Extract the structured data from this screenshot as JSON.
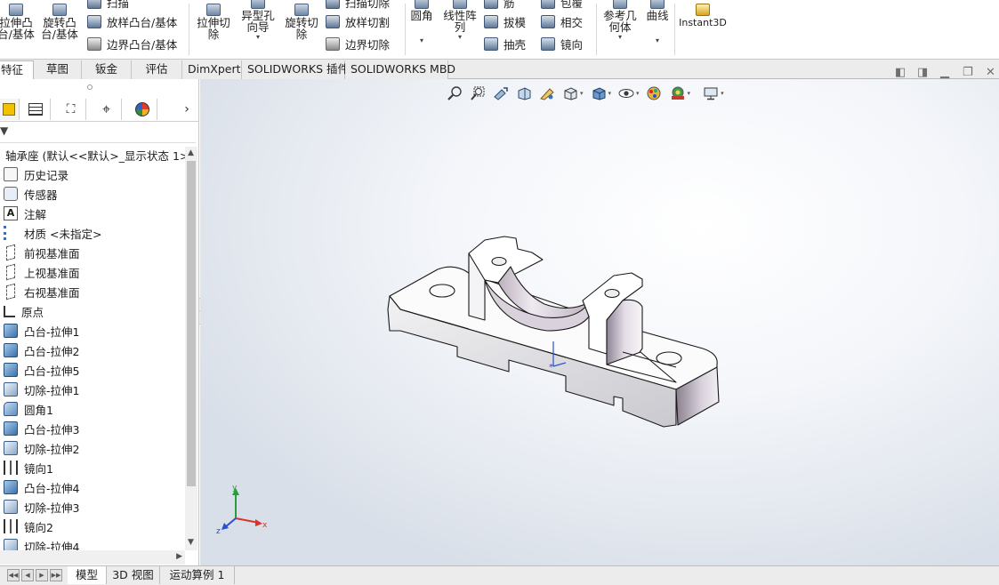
{
  "ribbon": {
    "buttons": [
      {
        "id": "extrude-boss",
        "label": "拉伸凸\n台/基体"
      },
      {
        "id": "revolve-boss",
        "label": "旋转凸\n台/基体"
      },
      {
        "id": "extrude-cut",
        "label": "拉伸切\n除"
      },
      {
        "id": "hole-wizard",
        "label": "异型孔\n向导"
      },
      {
        "id": "revolve-cut",
        "label": "旋转切\n除"
      },
      {
        "id": "fillet",
        "label": "圆角"
      },
      {
        "id": "linear-pattern",
        "label": "线性阵\n列"
      },
      {
        "id": "reference-geometry",
        "label": "参考几\n何体"
      },
      {
        "id": "curves",
        "label": "曲线"
      },
      {
        "id": "instant3d",
        "label": "Instant3D"
      }
    ],
    "small_buttons": [
      {
        "id": "sweep",
        "label": "扫描"
      },
      {
        "id": "loft-boss",
        "label": "放样凸台/基体"
      },
      {
        "id": "boundary-boss",
        "label": "边界凸台/基体"
      },
      {
        "id": "swept-cut",
        "label": "扫描切除"
      },
      {
        "id": "loft-cut",
        "label": "放样切割"
      },
      {
        "id": "boundary-cut",
        "label": "边界切除"
      },
      {
        "id": "rib",
        "label": "筋"
      },
      {
        "id": "draft",
        "label": "拔模"
      },
      {
        "id": "shell",
        "label": "抽壳"
      },
      {
        "id": "wrap",
        "label": "包覆"
      },
      {
        "id": "intersect",
        "label": "相交"
      },
      {
        "id": "mirror",
        "label": "镜向"
      }
    ],
    "dropdown_glyph": "▾"
  },
  "tabs": [
    "特征",
    "草图",
    "钣金",
    "评估",
    "DimXpert",
    "SOLIDWORKS 插件",
    "SOLIDWORKS MBD"
  ],
  "active_tab": "特征",
  "feature_tree": {
    "root": "轴承座 (默认<<默认>_显示状态 1>)",
    "items": [
      {
        "label": "历史记录",
        "icon": "history-icon"
      },
      {
        "label": "传感器",
        "icon": "sensor-icon"
      },
      {
        "label": "注解",
        "icon": "annotation-icon"
      },
      {
        "label": "材质 <未指定>",
        "icon": "material-icon"
      },
      {
        "label": "前视基准面",
        "icon": "plane-icon"
      },
      {
        "label": "上视基准面",
        "icon": "plane-icon"
      },
      {
        "label": "右视基准面",
        "icon": "plane-icon"
      },
      {
        "label": "原点",
        "icon": "origin-icon"
      },
      {
        "label": "凸台-拉伸1",
        "icon": "boss-extrude-icon"
      },
      {
        "label": "凸台-拉伸2",
        "icon": "boss-extrude-icon"
      },
      {
        "label": "凸台-拉伸5",
        "icon": "boss-extrude-icon"
      },
      {
        "label": "切除-拉伸1",
        "icon": "cut-extrude-icon"
      },
      {
        "label": "圆角1",
        "icon": "fillet-icon"
      },
      {
        "label": "凸台-拉伸3",
        "icon": "boss-extrude-icon"
      },
      {
        "label": "切除-拉伸2",
        "icon": "cut-extrude-icon"
      },
      {
        "label": "镜向1",
        "icon": "mirror-icon"
      },
      {
        "label": "凸台-拉伸4",
        "icon": "boss-extrude-icon"
      },
      {
        "label": "切除-拉伸3",
        "icon": "cut-extrude-icon"
      },
      {
        "label": "镜向2",
        "icon": "mirror-icon"
      },
      {
        "label": "切除-拉伸4",
        "icon": "cut-extrude-icon"
      }
    ]
  },
  "bottom_tabs": [
    "模型",
    "3D 视图",
    "运动算例 1"
  ],
  "active_bottom_tab": "模型",
  "triad": {
    "x": "x",
    "y": "y",
    "z": "z"
  },
  "colors": {
    "accent": "#2f6fb5",
    "x_axis": "#d8342a",
    "y_axis": "#2a9a3a",
    "z_axis": "#2a4fd0"
  }
}
